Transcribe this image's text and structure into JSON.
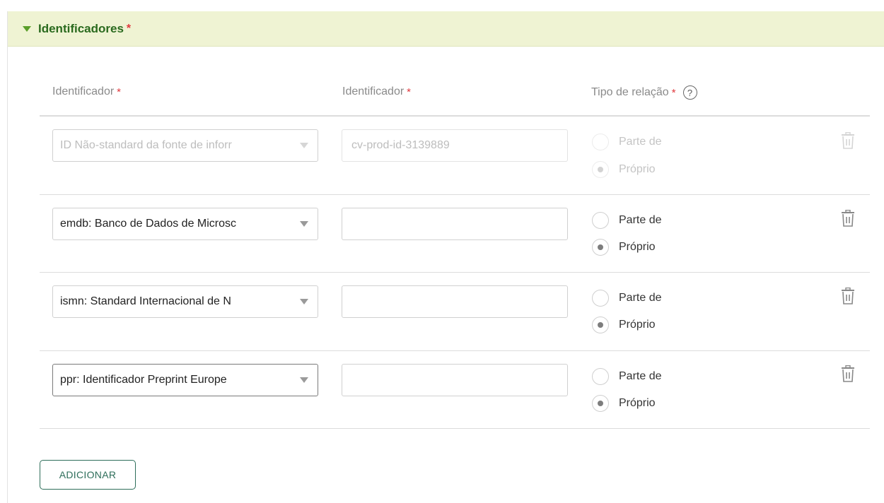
{
  "section": {
    "title": "Identificadores",
    "required_mark": "*"
  },
  "columns": {
    "id_type": "Identificador",
    "id_value": "Identificador",
    "relation": "Tipo de relação",
    "required_mark": "*",
    "help_glyph": "?"
  },
  "rows": [
    {
      "type_label": "ID Não-standard da fonte de inforr",
      "value": "cv-prod-id-3139889",
      "part_of_label": "Parte de",
      "own_label": "Próprio",
      "selected": "Próprio",
      "disabled": true
    },
    {
      "type_label": "emdb: Banco de Dados de Microsc",
      "value": "",
      "part_of_label": "Parte de",
      "own_label": "Próprio",
      "selected": "Próprio",
      "disabled": false
    },
    {
      "type_label": "ismn: Standard Internacional de N",
      "value": "",
      "part_of_label": "Parte de",
      "own_label": "Próprio",
      "selected": "Próprio",
      "disabled": false
    },
    {
      "type_label": "ppr: Identificador Preprint Europe",
      "value": "",
      "part_of_label": "Parte de",
      "own_label": "Próprio",
      "selected": "Próprio",
      "disabled": false
    }
  ],
  "actions": {
    "add_label": "ADICIONAR"
  },
  "icons": {
    "section_toggle": "caret-down-icon",
    "help": "question-circle-icon",
    "delete": "trash-icon"
  },
  "colors": {
    "header_bg": "#eff3d3",
    "header_text": "#2a6a1e",
    "required": "#e0393e",
    "button": "#2e6e5a"
  }
}
